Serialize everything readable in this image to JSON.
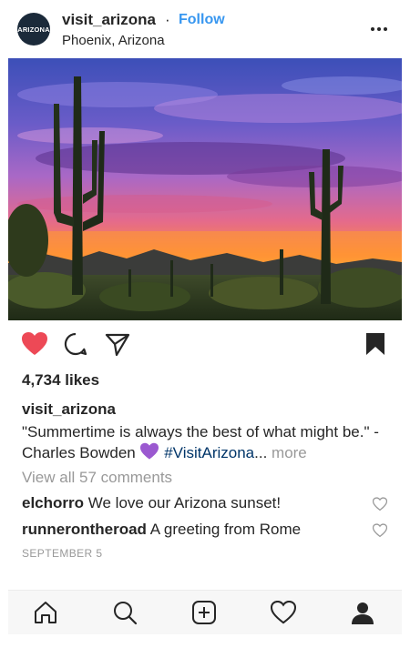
{
  "post": {
    "username": "visit_arizona",
    "separator": "·",
    "follow_label": "Follow",
    "location": "Phoenix, Arizona",
    "avatar_text": "ARIZONA",
    "likes": "4,734 likes",
    "caption_user": "visit_arizona",
    "caption_text": "\"Summertime is always the best of what might be.\" -Charles Bowden",
    "caption_hashtag": "#VisitArizona",
    "caption_ellipsis": "...",
    "caption_more": "more",
    "view_comments": "View all 57 comments",
    "comments": [
      {
        "user": "elchorro",
        "text": "We love our Arizona sunset!"
      },
      {
        "user": "runnerontheroad",
        "text": "A greeting from Rome"
      }
    ],
    "date": "SEPTEMBER 5"
  },
  "icons": {
    "more": "more-options-icon",
    "like": "heart-filled-icon",
    "comment": "comment-icon",
    "share": "send-icon",
    "save": "bookmark-filled-icon",
    "nav": [
      "home-icon",
      "search-icon",
      "add-post-icon",
      "activity-heart-icon",
      "profile-icon"
    ]
  },
  "colors": {
    "like_red": "#ed4956",
    "follow_blue": "#3897f0",
    "hashtag": "#003569",
    "muted": "#999999"
  }
}
